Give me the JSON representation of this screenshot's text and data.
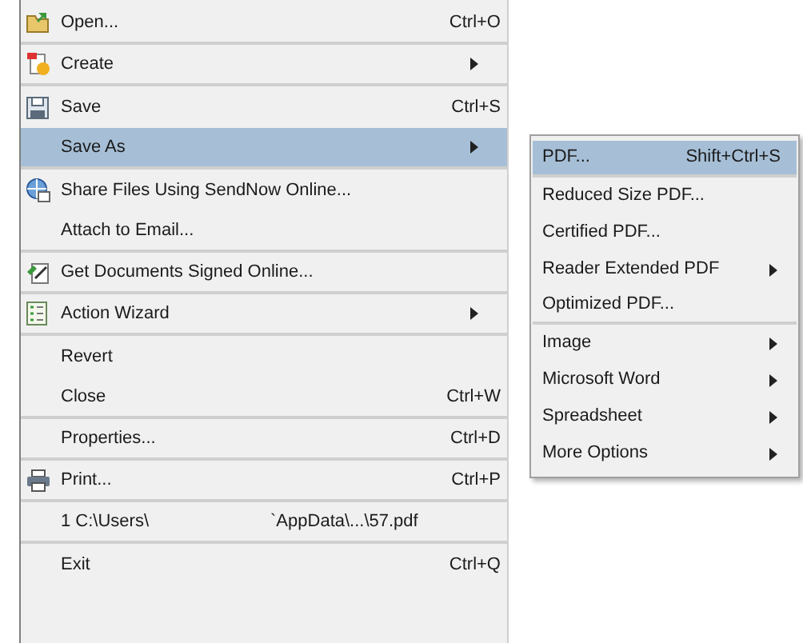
{
  "menu": {
    "items": [
      {
        "label": "Open...",
        "shortcut": "Ctrl+O",
        "submenu": false,
        "selected": false,
        "separator_after": true
      },
      {
        "label": "Create",
        "submenu": true,
        "selected": false,
        "separator_after": true
      },
      {
        "label": "Save",
        "shortcut": "Ctrl+S",
        "submenu": false,
        "selected": false,
        "separator_after": false
      },
      {
        "label": "Save As",
        "submenu": true,
        "selected": true,
        "separator_after": true
      },
      {
        "label": "Share Files Using SendNow Online...",
        "submenu": false,
        "selected": false,
        "separator_after": false
      },
      {
        "label": "Attach to Email...",
        "submenu": false,
        "selected": false,
        "separator_after": true
      },
      {
        "label": "Get Documents Signed Online...",
        "submenu": false,
        "selected": false,
        "separator_after": true
      },
      {
        "label": "Action Wizard",
        "submenu": true,
        "selected": false,
        "separator_after": true
      },
      {
        "label": "Revert",
        "submenu": false,
        "selected": false,
        "separator_after": false
      },
      {
        "label": "Close",
        "shortcut": "Ctrl+W",
        "submenu": false,
        "selected": false,
        "separator_after": true
      },
      {
        "label": "Properties...",
        "shortcut": "Ctrl+D",
        "submenu": false,
        "selected": false,
        "separator_after": true
      },
      {
        "label": "Print...",
        "shortcut": "Ctrl+P",
        "submenu": false,
        "selected": false,
        "separator_after": true
      },
      {
        "label": "1 C:\\Users\\",
        "label_2": "`AppData\\...\\57.pdf",
        "submenu": false,
        "selected": false,
        "separator_after": true
      },
      {
        "label": "Exit",
        "shortcut": "Ctrl+Q",
        "submenu": false,
        "selected": false,
        "separator_after": false
      }
    ]
  },
  "submenu": {
    "items": [
      {
        "label": "PDF...",
        "shortcut": "Shift+Ctrl+S",
        "submenu": false,
        "selected": true,
        "separator_after": true
      },
      {
        "label": "Reduced Size PDF...",
        "submenu": false,
        "selected": false,
        "separator_after": false
      },
      {
        "label": "Certified PDF...",
        "submenu": false,
        "selected": false,
        "separator_after": false
      },
      {
        "label": "Reader Extended PDF",
        "submenu": true,
        "selected": false,
        "separator_after": false
      },
      {
        "label": "Optimized PDF...",
        "submenu": false,
        "selected": false,
        "separator_after": true
      },
      {
        "label": "Image",
        "submenu": true,
        "selected": false,
        "separator_after": false
      },
      {
        "label": "Microsoft Word",
        "submenu": true,
        "selected": false,
        "separator_after": false
      },
      {
        "label": "Spreadsheet",
        "submenu": true,
        "selected": false,
        "separator_after": false
      },
      {
        "label": "More Options",
        "submenu": true,
        "selected": false,
        "separator_after": false
      }
    ]
  }
}
